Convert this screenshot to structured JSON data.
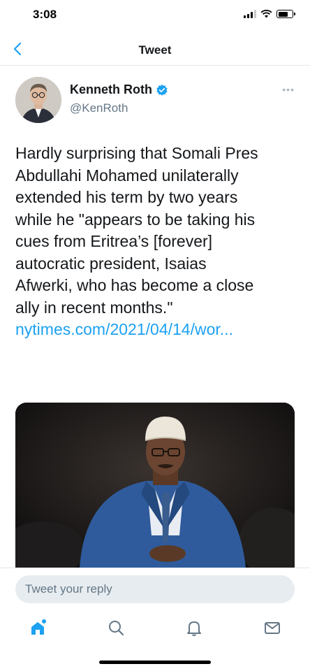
{
  "status_bar": {
    "time": "3:08"
  },
  "nav": {
    "title": "Tweet"
  },
  "tweet": {
    "author_name": "Kenneth Roth",
    "author_handle": "@KenRoth",
    "more_label": "•••",
    "text_lines": [
      "Hardly surprising that Somali Pres",
      "Abdullahi Mohamed unilaterally",
      "extended his term by two years",
      "while he \"appears to be taking his",
      "cues from Eritrea’s [forever]",
      "autocratic president, Isaias",
      "Afwerki, who has become a close",
      "ally in recent months.\""
    ],
    "link": "nytimes.com/2021/04/14/wor..."
  },
  "reply": {
    "placeholder": "Tweet your reply"
  },
  "colors": {
    "accent": "#1da1f2",
    "text": "#14171a",
    "secondary": "#657786",
    "divider": "#e1e8ed",
    "input_bg": "#e6ecf0"
  },
  "icons": {
    "back": "chevron-left-icon",
    "verified": "verified-badge-icon",
    "home": "home-icon",
    "search": "search-icon",
    "notifications": "bell-icon",
    "messages": "mail-icon"
  }
}
